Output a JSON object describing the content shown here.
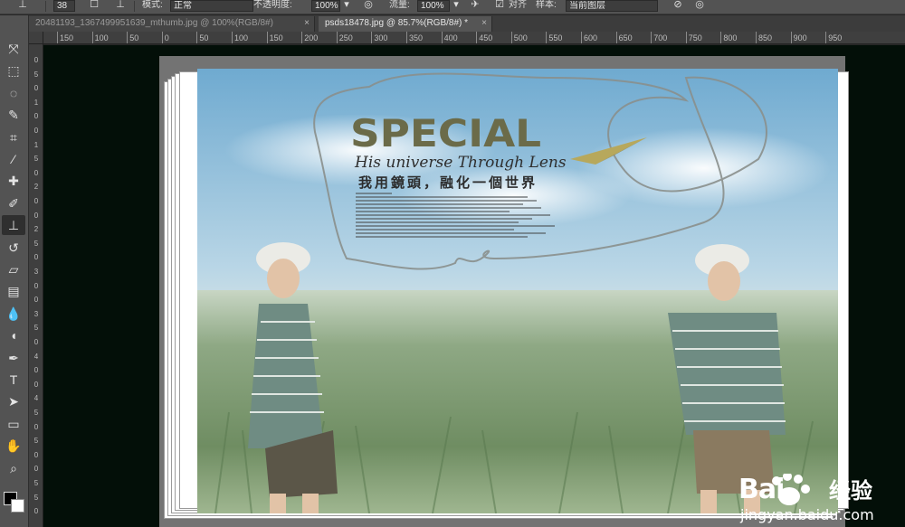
{
  "options_bar": {
    "brush_size": "38",
    "mode_label": "模式:",
    "mode_value": "正常",
    "opacity_label": "不透明度:",
    "opacity_value": "100%",
    "flow_label": "流量:",
    "flow_value": "100%",
    "aligned_label": "对齐",
    "sample_label": "样本:",
    "sample_value": "当前图层"
  },
  "tabs": [
    {
      "label": "20481193_1367499951639_mthumb.jpg @ 100%(RGB/8#)",
      "close": "×",
      "active": false
    },
    {
      "label": "psds18478.jpg @ 85.7%(RGB/8#) *",
      "close": "×",
      "active": true
    }
  ],
  "ruler": {
    "top_ticks": [
      "150",
      "100",
      "50",
      "0",
      "50",
      "100",
      "150",
      "200",
      "250",
      "300",
      "350",
      "400",
      "450",
      "500",
      "550",
      "600",
      "650",
      "700",
      "750",
      "800",
      "850",
      "900",
      "950"
    ],
    "left_labels": [
      "0",
      "5",
      "0",
      "1",
      "0",
      "0",
      "1",
      "5",
      "0",
      "2",
      "0",
      "0",
      "2",
      "5",
      "0",
      "3",
      "0",
      "0",
      "3",
      "5",
      "0",
      "4",
      "0",
      "0",
      "4",
      "5",
      "0",
      "5",
      "0",
      "0",
      "5",
      "5",
      "0"
    ]
  },
  "toolbar": {
    "tools": [
      {
        "name": "move-tool",
        "glyph": "⤧"
      },
      {
        "name": "marquee-tool",
        "glyph": "⬚"
      },
      {
        "name": "lasso-tool",
        "glyph": "◌"
      },
      {
        "name": "quick-selection-tool",
        "glyph": "✎"
      },
      {
        "name": "crop-tool",
        "glyph": "⌗"
      },
      {
        "name": "eyedropper-tool",
        "glyph": "⁄"
      },
      {
        "name": "healing-brush-tool",
        "glyph": "✚"
      },
      {
        "name": "brush-tool",
        "glyph": "✐"
      },
      {
        "name": "clone-stamp-tool",
        "glyph": "⊥"
      },
      {
        "name": "history-brush-tool",
        "glyph": "↺"
      },
      {
        "name": "eraser-tool",
        "glyph": "▱"
      },
      {
        "name": "gradient-tool",
        "glyph": "▤"
      },
      {
        "name": "blur-tool",
        "glyph": "💧"
      },
      {
        "name": "dodge-tool",
        "glyph": "◖"
      },
      {
        "name": "pen-tool",
        "glyph": "✒"
      },
      {
        "name": "type-tool",
        "glyph": "T"
      },
      {
        "name": "path-selection-tool",
        "glyph": "➤"
      },
      {
        "name": "rectangle-tool",
        "glyph": "▭"
      },
      {
        "name": "hand-tool",
        "glyph": "✋"
      },
      {
        "name": "zoom-tool",
        "glyph": "⌕"
      }
    ],
    "active_tool": "clone-stamp-tool",
    "foreground_color": "#000000",
    "background_color": "#ffffff"
  },
  "artwork": {
    "title": "SPECIAL",
    "subtitle": "His universe Through Lens",
    "tagline": "我用鏡頭，融化一個世界"
  },
  "watermark": {
    "brand_text": "Bai",
    "brand_suffix": "经验",
    "url": "jingyan.baidu.com"
  }
}
